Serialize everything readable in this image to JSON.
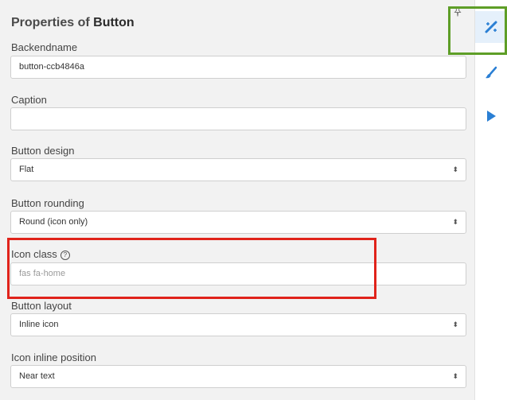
{
  "panel": {
    "title_prefix": "Properties of",
    "title_object": "Button",
    "pin_icon": "pin-icon"
  },
  "fields": {
    "backendname": {
      "label": "Backendname",
      "value": "button-ccb4846a"
    },
    "caption": {
      "label": "Caption",
      "value": ""
    },
    "button_design": {
      "label": "Button design",
      "value": "Flat"
    },
    "button_rounding": {
      "label": "Button rounding",
      "value": "Round (icon only)"
    },
    "icon_class": {
      "label": "Icon class",
      "placeholder": "fas fa-home",
      "help_icon": "question-circle-icon"
    },
    "button_layout": {
      "label": "Button layout",
      "value": "Inline icon"
    },
    "icon_inline_position": {
      "label": "Icon inline position",
      "value": "Near text"
    }
  },
  "sidebar": {
    "items": [
      {
        "icon": "wand-icon",
        "active": true
      },
      {
        "icon": "brush-icon",
        "active": false
      },
      {
        "icon": "play-icon",
        "active": false
      }
    ]
  },
  "colors": {
    "accent": "#2a7fd4",
    "highlight_red": "#e0231b",
    "highlight_green": "#5e9e27"
  }
}
